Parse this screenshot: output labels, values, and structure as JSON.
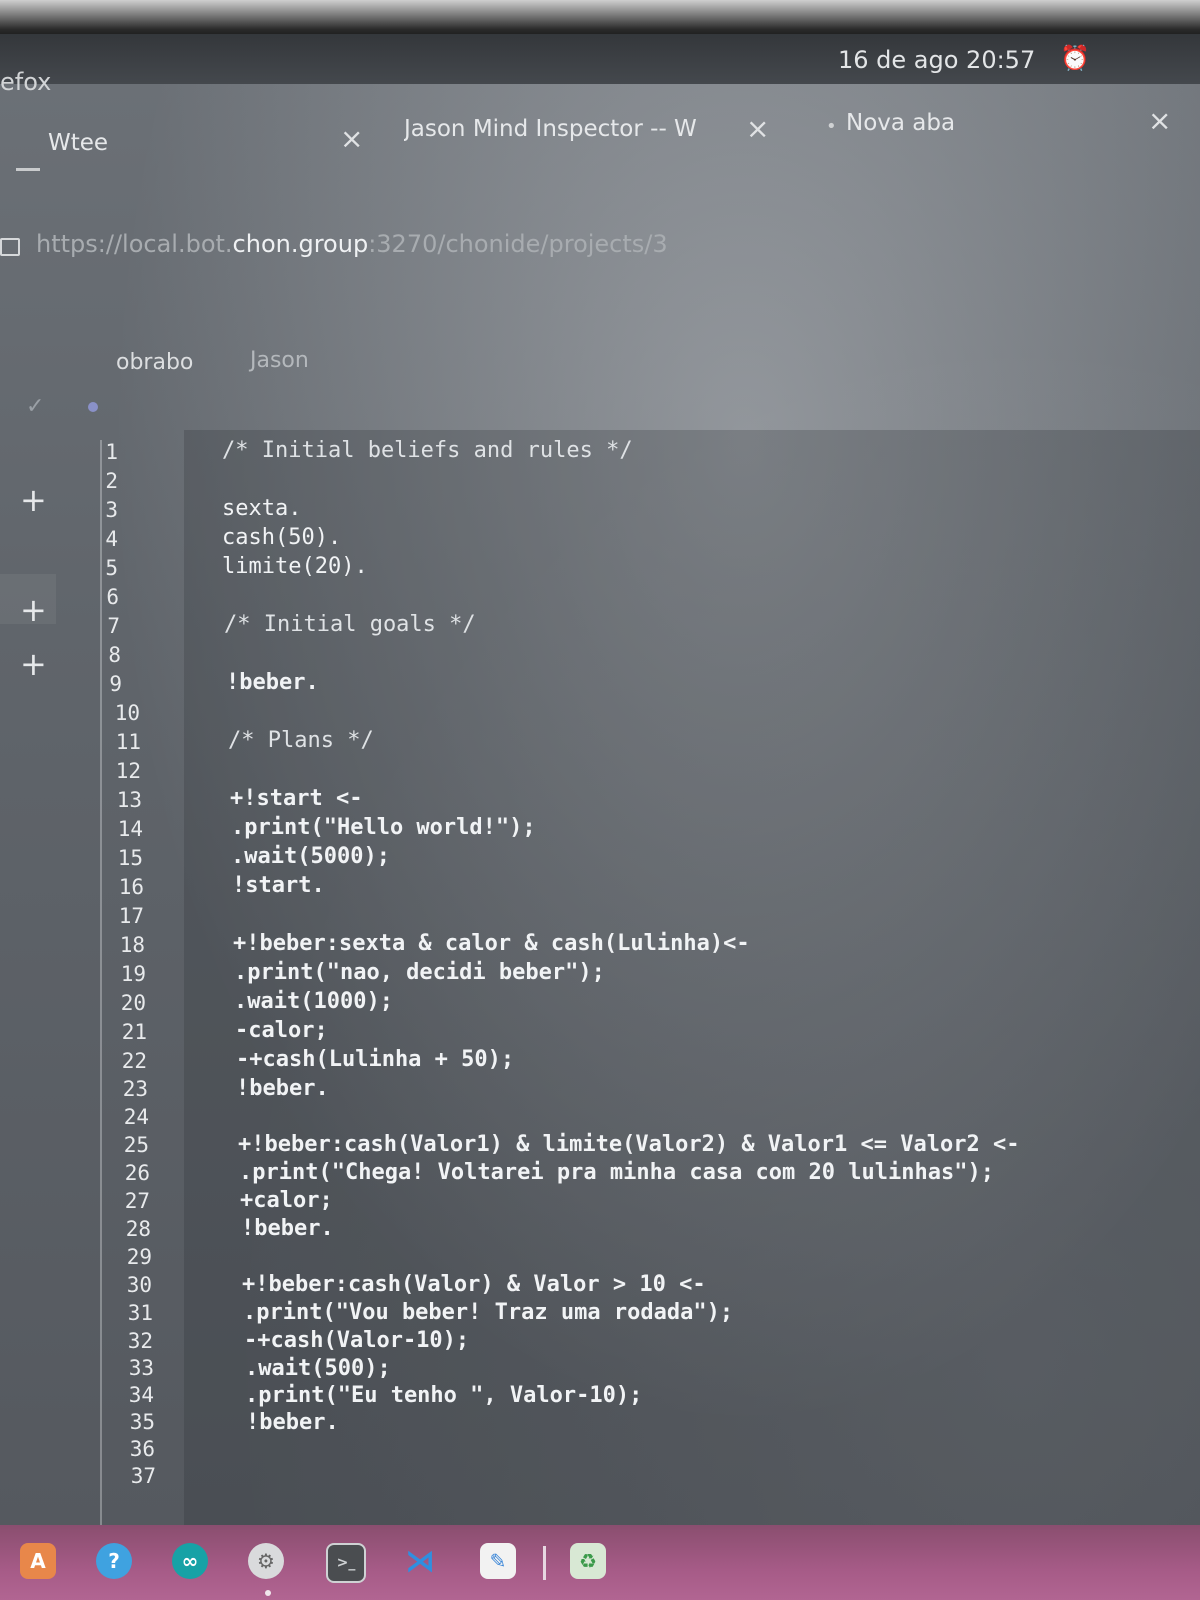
{
  "system": {
    "app_name": "efox",
    "clock": "16 de ago  20:57"
  },
  "tabs": [
    {
      "label": "Wtee"
    },
    {
      "label": "Jason Mind Inspector -- W"
    },
    {
      "label": "Nova aba"
    }
  ],
  "address_bar": {
    "prefix": "https://local.bot.",
    "host": "chon.group",
    "suffix": ":3270/chonide/projects/3"
  },
  "project_tabs": [
    {
      "label": "obrabo"
    },
    {
      "label": "Jason"
    }
  ],
  "editor": {
    "line_numbers": [
      "1",
      "2",
      "3",
      "4",
      "5",
      "6",
      "7",
      "8",
      "9",
      "10",
      "11",
      "12",
      "13",
      "14",
      "15",
      "16",
      "17",
      "18",
      "19",
      "20",
      "21",
      "22",
      "23",
      "24",
      "25",
      "26",
      "27",
      "28",
      "29",
      "30",
      "31",
      "32",
      "33",
      "34",
      "35",
      "36",
      "37"
    ],
    "lines": [
      "/* Initial beliefs and rules */",
      "",
      "sexta.",
      "cash(50).",
      "limite(20).",
      "",
      "/* Initial goals */",
      "",
      "!beber.",
      "",
      "/* Plans */",
      "",
      "+!start <-",
      ".print(\"Hello world!\");",
      ".wait(5000);",
      "!start.",
      "",
      "+!beber:sexta & calor & cash(Lulinha)<-",
      ".print(\"nao, decidi beber\");",
      ".wait(1000);",
      "-calor;",
      "-+cash(Lulinha + 50);",
      "!beber.",
      "",
      "+!beber:cash(Valor1) & limite(Valor2) & Valor1 <= Valor2 <-",
      ".print(\"Chega! Voltarei pra minha casa com 20 lulinhas\");",
      "+calor;",
      "!beber.",
      "",
      "+!beber:cash(Valor) & Valor > 10 <-",
      ".print(\"Vou beber! Traz uma rodada\");",
      "-+cash(Valor-10);",
      ".wait(500);",
      ".print(\"Eu tenho \", Valor-10);",
      "!beber.",
      "",
      ""
    ]
  },
  "icons": {
    "lock": "lock-icon",
    "bell": "alarm-bell-icon",
    "dock": [
      "software-store-icon",
      "help-icon",
      "arduino-icon",
      "settings-icon",
      "terminal-icon",
      "vscode-icon",
      "text-editor-icon",
      "trash-icon"
    ]
  },
  "colors": {
    "dock": "#a65b87",
    "text": "#f1f3f5",
    "screen": "#60656b"
  }
}
